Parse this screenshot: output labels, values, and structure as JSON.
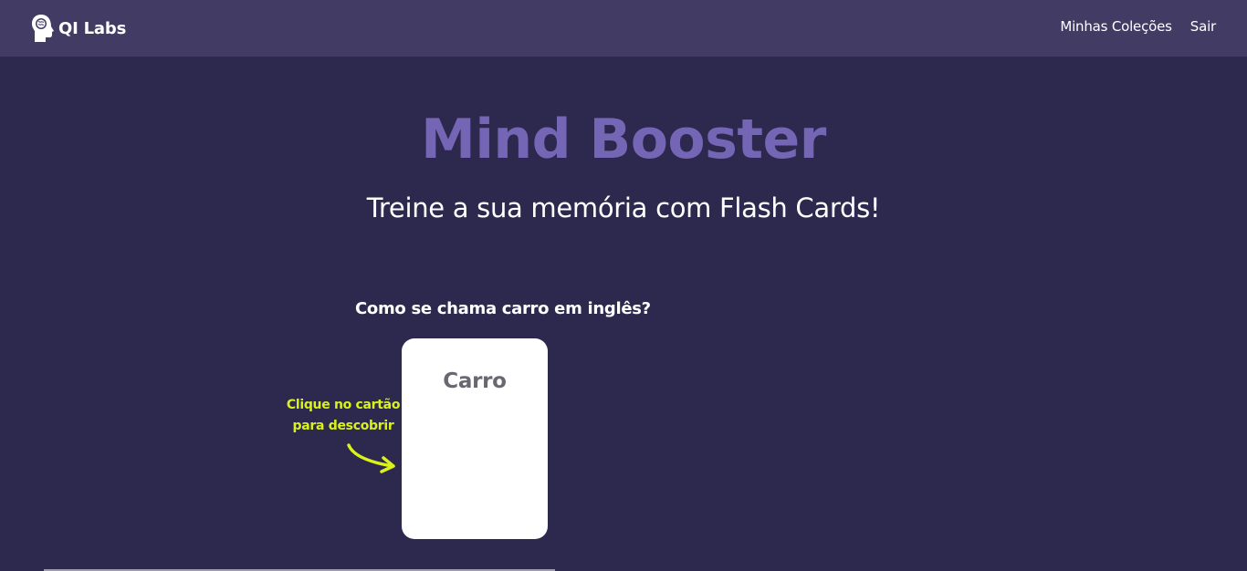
{
  "navbar": {
    "brand_text": "QI Labs",
    "brand_icon": "brain-head-icon",
    "links": [
      {
        "label": "Minhas Coleções"
      },
      {
        "label": "Sair"
      }
    ]
  },
  "hero": {
    "title": "Mind Booster",
    "subtitle": "Treine a sua memória com Flash Cards!"
  },
  "quiz": {
    "question": "Como se chama carro em inglês?",
    "hint_line1": "Clique no cartão",
    "hint_line2": "para descobrir",
    "card_text": "Carro"
  },
  "colors": {
    "background": "#2d284e",
    "navbar": "#423c64",
    "title": "#7466b5",
    "hint": "#d9f21c",
    "card": "#ffffff"
  }
}
